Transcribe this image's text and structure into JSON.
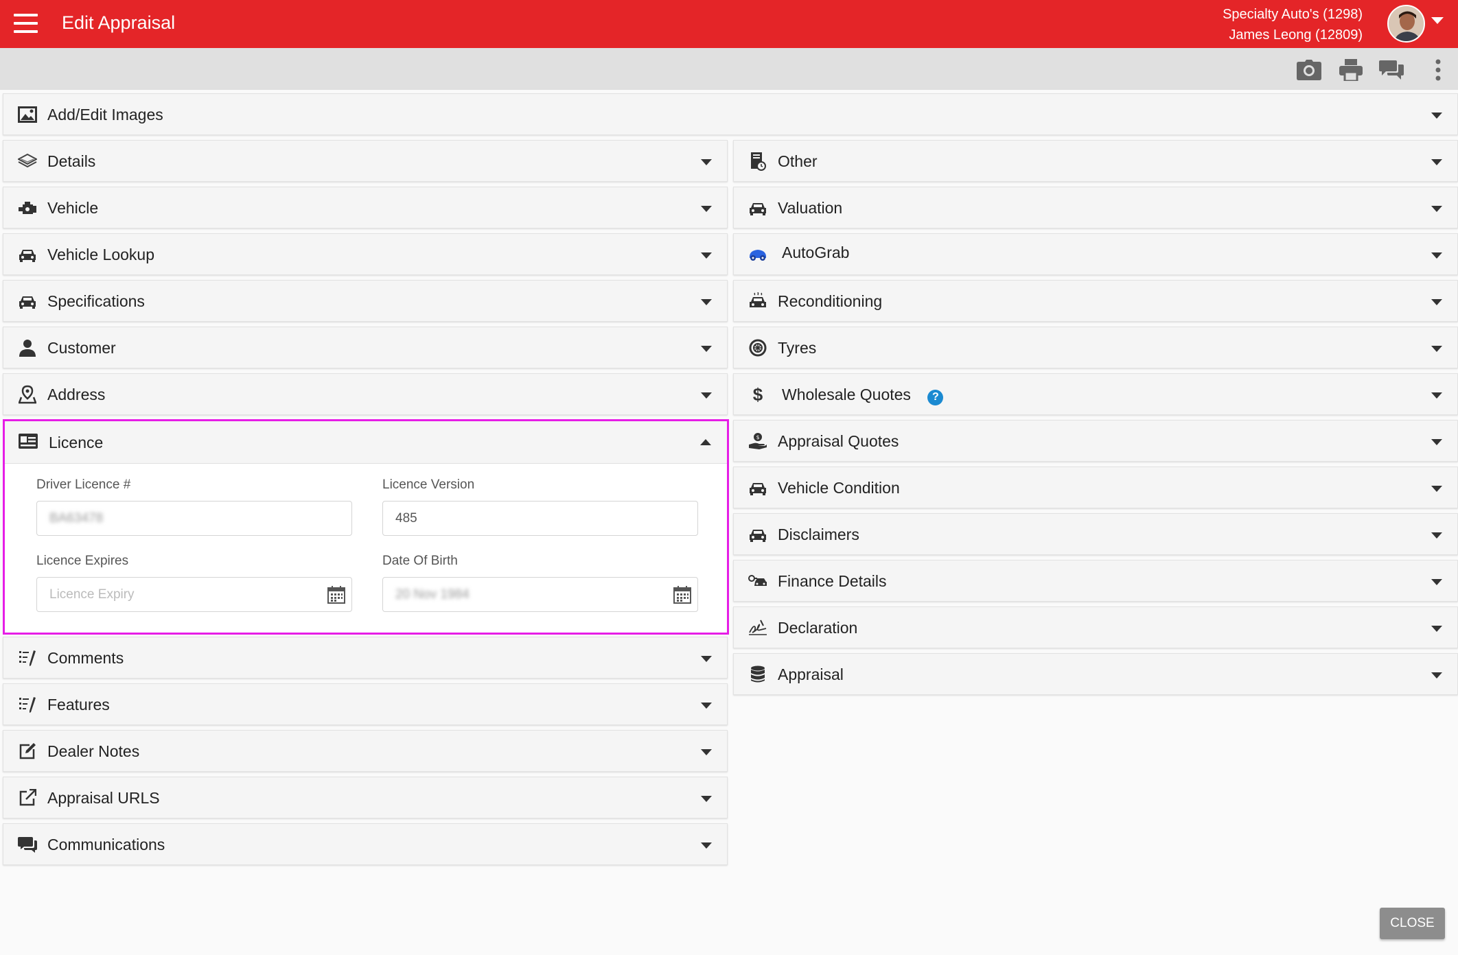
{
  "header": {
    "title": "Edit Appraisal",
    "dealer": "Specialty Auto's (1298)",
    "user": "James Leong (12809)"
  },
  "toolbar": {
    "icons": [
      "camera-icon",
      "print-icon",
      "chat-icon",
      "more-vert-icon"
    ]
  },
  "panels": {
    "add_edit_images": "Add/Edit Images",
    "left": [
      {
        "key": "details",
        "label": "Details",
        "icon": "layers-icon"
      },
      {
        "key": "vehicle",
        "label": "Vehicle",
        "icon": "engine-icon"
      },
      {
        "key": "vehicle_lookup",
        "label": "Vehicle Lookup",
        "icon": "car-search-icon"
      },
      {
        "key": "specifications",
        "label": "Specifications",
        "icon": "car-icon"
      },
      {
        "key": "customer",
        "label": "Customer",
        "icon": "person-icon"
      },
      {
        "key": "address",
        "label": "Address",
        "icon": "location-icon"
      }
    ],
    "left_after": [
      {
        "key": "comments",
        "label": "Comments",
        "icon": "checklist-pen-icon"
      },
      {
        "key": "features",
        "label": "Features",
        "icon": "checklist-pen-icon"
      },
      {
        "key": "dealer_notes",
        "label": "Dealer Notes",
        "icon": "edit-note-icon"
      },
      {
        "key": "appraisal_urls",
        "label": "Appraisal URLS",
        "icon": "external-link-icon"
      },
      {
        "key": "communications",
        "label": "Communications",
        "icon": "chat-icon"
      }
    ],
    "right": [
      {
        "key": "other",
        "label": "Other",
        "icon": "document-clock-icon"
      },
      {
        "key": "valuation",
        "label": "Valuation",
        "icon": "car-icon"
      },
      {
        "key": "autograb",
        "label": "AutoGrab",
        "icon": "autograb-car-icon"
      },
      {
        "key": "reconditioning",
        "label": "Reconditioning",
        "icon": "car-wash-icon"
      },
      {
        "key": "tyres",
        "label": "Tyres",
        "icon": "tyre-icon"
      },
      {
        "key": "wholesale_quotes",
        "label": "Wholesale Quotes",
        "icon": "dollar-icon"
      },
      {
        "key": "appraisal_quotes",
        "label": "Appraisal Quotes",
        "icon": "hand-money-icon"
      },
      {
        "key": "vehicle_condition",
        "label": "Vehicle Condition",
        "icon": "car-icon"
      },
      {
        "key": "disclaimers",
        "label": "Disclaimers",
        "icon": "car-icon"
      },
      {
        "key": "finance_details",
        "label": "Finance Details",
        "icon": "car-key-icon"
      },
      {
        "key": "declaration",
        "label": "Declaration",
        "icon": "signature-icon"
      },
      {
        "key": "appraisal",
        "label": "Appraisal",
        "icon": "database-icon"
      }
    ]
  },
  "licence": {
    "title": "Licence",
    "driver_licence_label": "Driver Licence #",
    "driver_licence_value": "BA63478",
    "version_label": "Licence Version",
    "version_value": "485",
    "expires_label": "Licence Expires",
    "expires_placeholder": "Licence Expiry",
    "dob_label": "Date Of Birth",
    "dob_value": "20 Nov 1984"
  },
  "close_label": "CLOSE"
}
